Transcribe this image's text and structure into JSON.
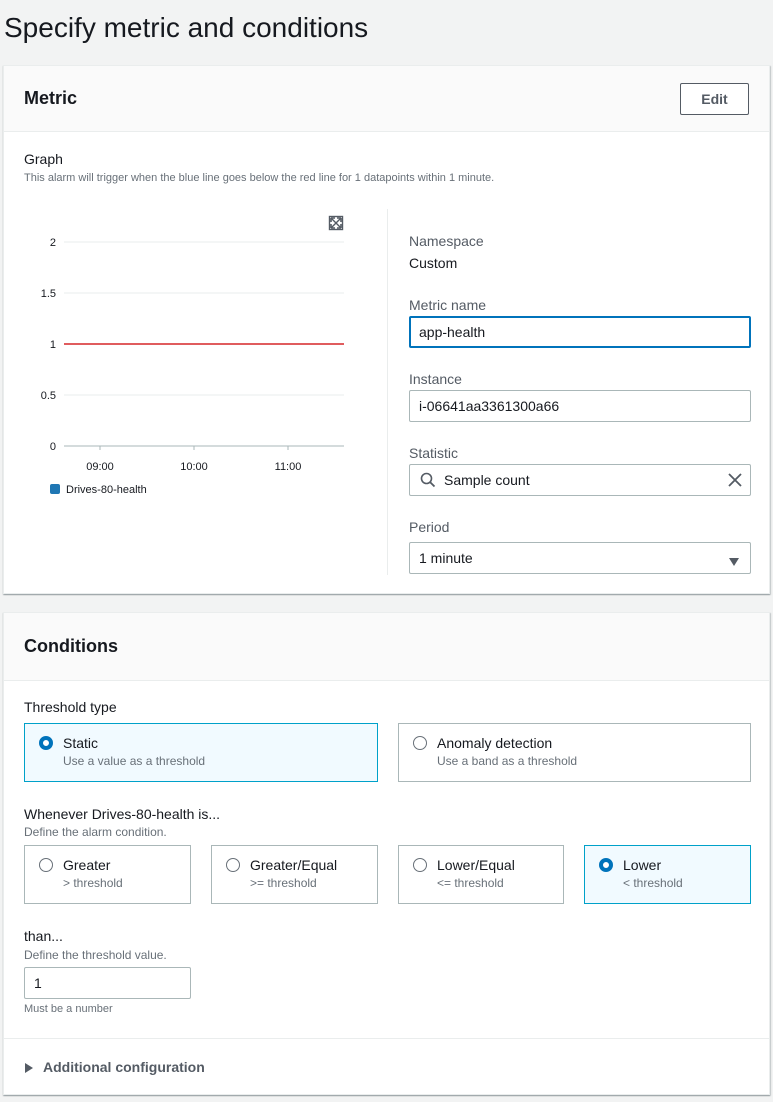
{
  "page": {
    "title": "Specify metric and conditions"
  },
  "metric": {
    "title": "Metric",
    "edit_label": "Edit",
    "graph": {
      "label": "Graph",
      "description": "This alarm will trigger when the blue line goes below the red line for 1 datapoints within 1 minute."
    },
    "namespace": {
      "label": "Namespace",
      "value": "Custom"
    },
    "metric_name": {
      "label": "Metric name",
      "value": "app-health"
    },
    "instance": {
      "label": "Instance",
      "value": "i-06641aa3361300a66"
    },
    "statistic": {
      "label": "Statistic",
      "value": "Sample count"
    },
    "period": {
      "label": "Period",
      "value": "1 minute"
    }
  },
  "chart_data": {
    "type": "line",
    "title": "",
    "xlabel": "",
    "ylabel": "",
    "x_ticks": [
      "09:00",
      "10:00",
      "11:00"
    ],
    "y_ticks": [
      "2",
      "1.5",
      "1",
      "0.5",
      "0"
    ],
    "ylim": [
      0,
      2
    ],
    "grid": true,
    "legend_position": "bottom-left",
    "series": [
      {
        "name": "Drives-80-health",
        "color": "#1f77b4",
        "values": []
      }
    ],
    "threshold": {
      "value": 1,
      "color": "#d62728"
    }
  },
  "conditions": {
    "title": "Conditions",
    "threshold_type": {
      "label": "Threshold type",
      "options": [
        {
          "label": "Static",
          "description": "Use a value as a threshold",
          "selected": true
        },
        {
          "label": "Anomaly detection",
          "description": "Use a band as a threshold",
          "selected": false
        }
      ]
    },
    "whenever": {
      "label": "Whenever Drives-80-health is...",
      "description": "Define the alarm condition.",
      "options": [
        {
          "label": "Greater",
          "description": "> threshold",
          "selected": false
        },
        {
          "label": "Greater/Equal",
          "description": ">= threshold",
          "selected": false
        },
        {
          "label": "Lower/Equal",
          "description": "<= threshold",
          "selected": false
        },
        {
          "label": "Lower",
          "description": "< threshold",
          "selected": true
        }
      ]
    },
    "than": {
      "label": "than...",
      "description": "Define the threshold value.",
      "value": "1",
      "constraint": "Must be a number"
    },
    "additional_label": "Additional configuration"
  },
  "colors": {
    "accent": "#0073bb",
    "selected_border": "#00a1c9",
    "selected_bg": "#f1faff",
    "threshold_line": "#d62728",
    "series_line": "#1f77b4"
  }
}
